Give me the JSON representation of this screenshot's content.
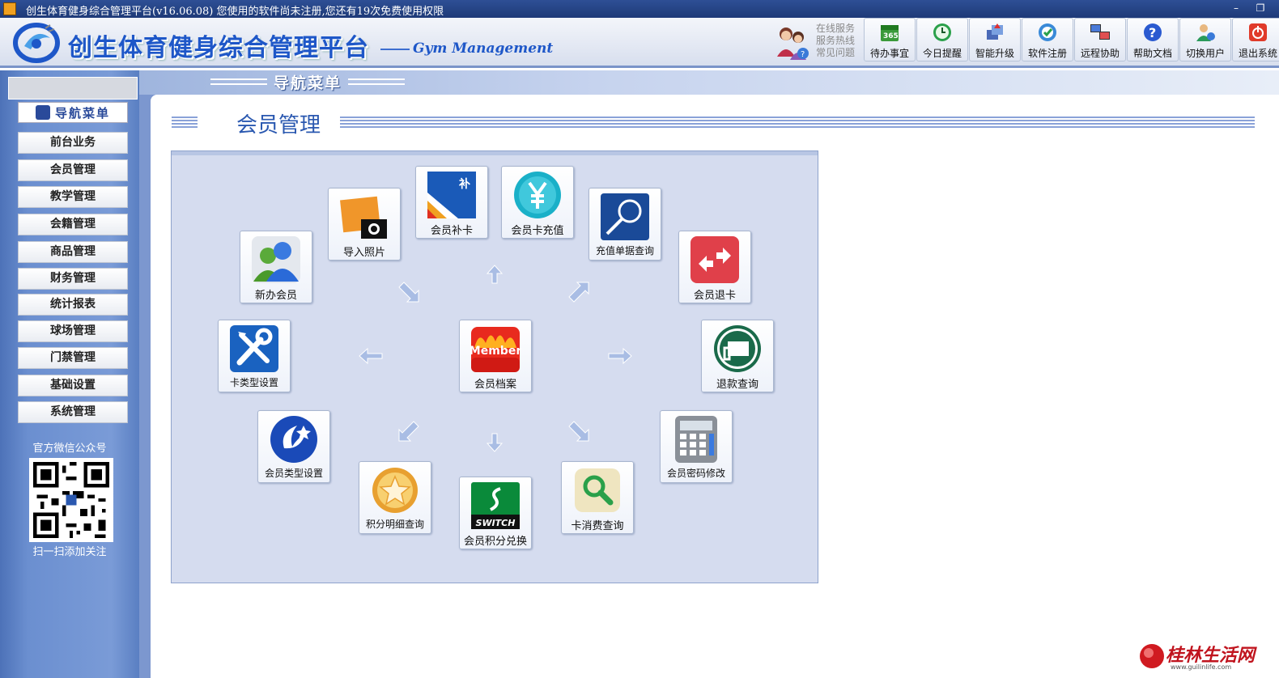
{
  "window": {
    "title": "创生体育健身综合管理平台(v16.06.08)   您使用的软件尚未注册,您还有19次免费使用权限",
    "minimize_label": "–",
    "restore_label": "❐"
  },
  "header": {
    "brand": "创生体育健身综合管理平台",
    "brand_sub": "Gym Management",
    "service_lines": [
      "在线服务",
      "服务热线",
      "常见问题"
    ],
    "toolbar": [
      {
        "label": "待办事宜",
        "icon": "calendar-365-icon"
      },
      {
        "label": "今日提醒",
        "icon": "clock-icon"
      },
      {
        "label": "智能升级",
        "icon": "upgrade-icon"
      },
      {
        "label": "软件注册",
        "icon": "register-icon"
      },
      {
        "label": "远程协助",
        "icon": "remote-icon"
      },
      {
        "label": "帮助文档",
        "icon": "help-icon"
      },
      {
        "label": "切换用户",
        "icon": "user-switch-icon"
      },
      {
        "label": "退出系统",
        "icon": "exit-icon"
      }
    ]
  },
  "sidebar": {
    "title": "导航菜单",
    "items": [
      "前台业务",
      "会员管理",
      "教学管理",
      "会籍管理",
      "商品管理",
      "财务管理",
      "统计报表",
      "球场管理",
      "门禁管理",
      "基础设置",
      "系统管理"
    ],
    "wechat_label": "官方微信公众号",
    "scan_label": "扫一扫添加关注"
  },
  "main": {
    "tab_label": "导航菜单",
    "section_title": "会员管理",
    "tiles": {
      "member_archive": "会员档案",
      "new_member": "新办会员",
      "import_photo": "导入照片",
      "card_reissue": "会员补卡",
      "card_recharge": "会员卡充值",
      "recharge_query": "充值单据查询",
      "card_refund": "会员退卡",
      "refund_query": "退款查询",
      "password_change": "会员密码修改",
      "consume_query": "卡消费查询",
      "points_exchange": "会员积分兑换",
      "points_detail": "积分明细查询",
      "member_type_setting": "会员类型设置",
      "card_type_setting": "卡类型设置"
    },
    "member_badge": "Member",
    "switch_badge": "SWITCH",
    "reissue_badge": "补"
  },
  "watermark": {
    "text": "桂林生活网",
    "url": "www.guilinlife.com"
  }
}
